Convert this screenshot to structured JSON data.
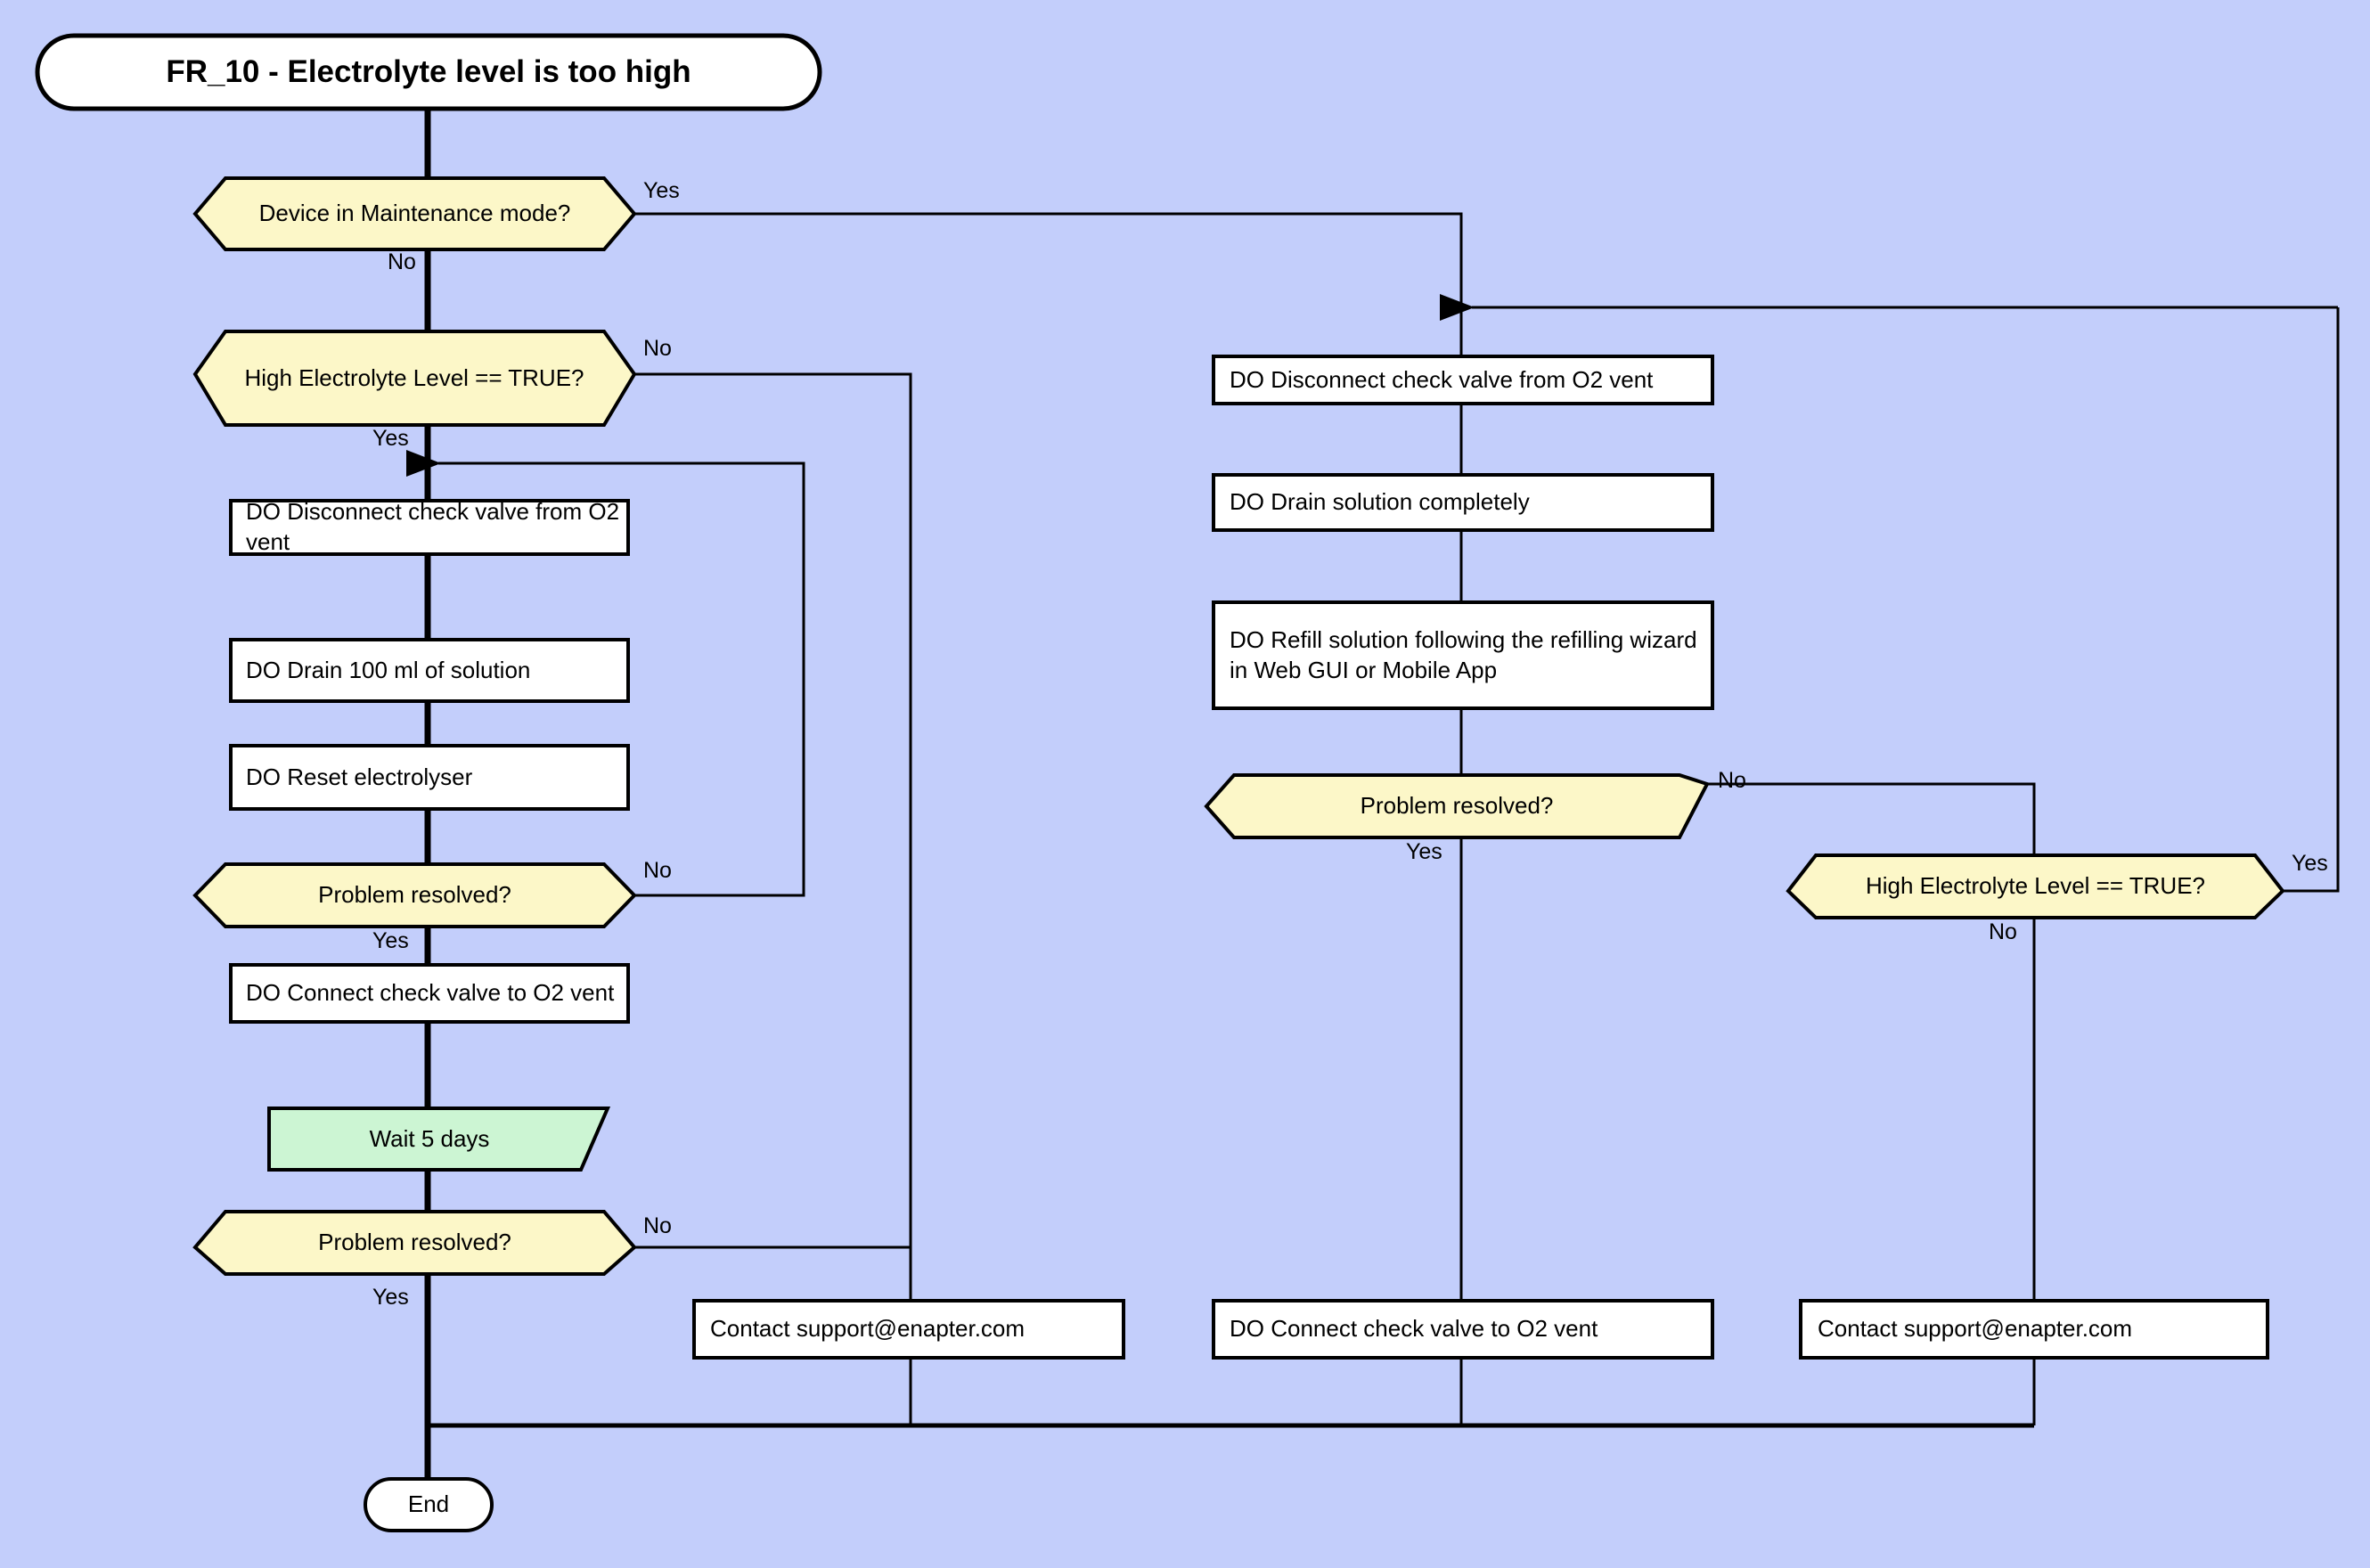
{
  "diagram": {
    "title": "FR_10 - Electrolyte level is too high",
    "background_color": "#c3cefb",
    "stroke_color": "#000000",
    "process_fill": "#ffffff",
    "decision_fill": "#fcf7c8",
    "delay_fill": "#ccf5d3",
    "terminator_fill": "#ffffff"
  },
  "nodes": {
    "start": {
      "label": "FR_10 - Electrolyte level is too high",
      "shape": "terminator"
    },
    "dec_maintenance": {
      "label": "Device in Maintenance mode?",
      "shape": "decision"
    },
    "dec_high_level_left": {
      "label": "High Electrolyte Level == TRUE?",
      "shape": "decision"
    },
    "proc_disconnect_left": {
      "label": "DO Disconnect check valve from O2 vent",
      "shape": "process"
    },
    "proc_drain_100": {
      "label": "DO Drain 100 ml of solution",
      "shape": "process"
    },
    "proc_reset": {
      "label": "DO Reset electrolyser",
      "shape": "process"
    },
    "dec_resolved_left_1": {
      "label": "Problem resolved?",
      "shape": "decision"
    },
    "proc_connect_left": {
      "label": "DO Connect check valve to O2 vent",
      "shape": "process"
    },
    "delay_wait": {
      "label": "Wait 5 days",
      "shape": "delay"
    },
    "dec_resolved_left_2": {
      "label": "Problem resolved?",
      "shape": "decision"
    },
    "contact_left": {
      "label": "Contact support@enapter.com",
      "shape": "process"
    },
    "end": {
      "label": "End",
      "shape": "terminator"
    },
    "proc_disconnect_right": {
      "label": "DO Disconnect check valve from O2 vent",
      "shape": "process"
    },
    "proc_drain_complete": {
      "label": "DO Drain solution completely",
      "shape": "process"
    },
    "proc_refill": {
      "label": "DO Refill solution following the refilling wizard in Web GUI or Mobile App",
      "shape": "process"
    },
    "dec_resolved_right": {
      "label": "Problem resolved?",
      "shape": "decision"
    },
    "dec_high_level_right": {
      "label": "High Electrolyte Level == TRUE?",
      "shape": "decision"
    },
    "proc_connect_right": {
      "label": "DO Connect check valve to O2 vent",
      "shape": "process"
    },
    "contact_right": {
      "label": "Contact support@enapter.com",
      "shape": "process"
    }
  },
  "edge_labels": {
    "maintenance_yes": "Yes",
    "maintenance_no": "No",
    "high_level_left_no": "No",
    "high_level_left_yes": "Yes",
    "resolved_left_1_no": "No",
    "resolved_left_1_yes": "Yes",
    "resolved_left_2_no": "No",
    "resolved_left_2_yes": "Yes",
    "resolved_right_no": "No",
    "resolved_right_yes": "Yes",
    "high_level_right_yes": "Yes",
    "high_level_right_no": "No"
  }
}
